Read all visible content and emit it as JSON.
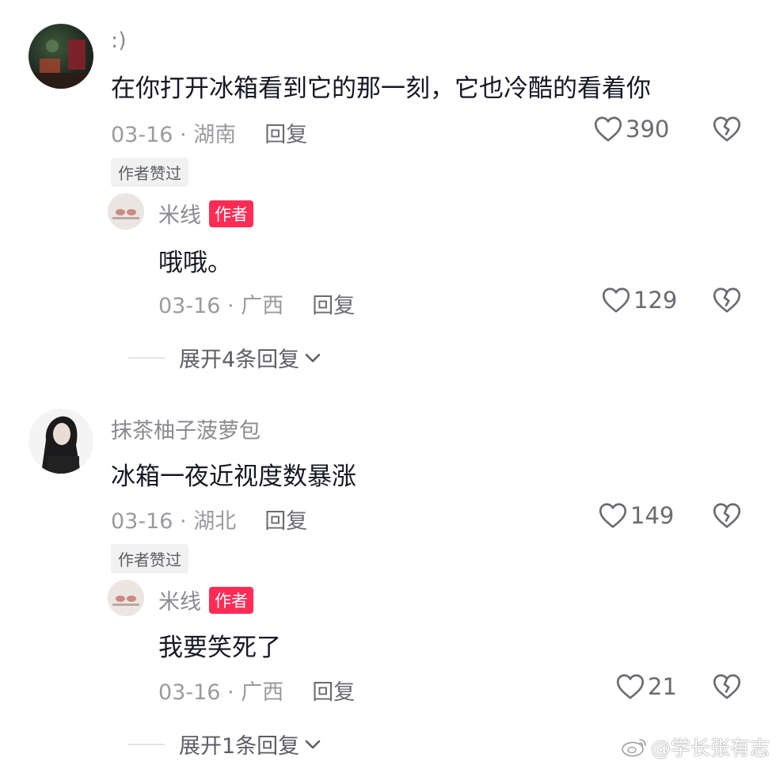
{
  "comments": [
    {
      "username": ":)",
      "text": "在你打开冰箱看到它的那一刻，它也冷酷的看着你",
      "date": "03-16",
      "location": "湖南",
      "reply_label": "回复",
      "likes": "390",
      "liked_by_author": "作者赞过",
      "author_reply": {
        "username": "米线",
        "author_tag": "作者",
        "text": "哦哦。",
        "date": "03-16",
        "location": "广西",
        "reply_label": "回复",
        "likes": "129"
      },
      "expand_label": "展开4条回复"
    },
    {
      "username": "抹茶柚子菠萝包",
      "text": "冰箱一夜近视度数暴涨",
      "date": "03-16",
      "location": "湖北",
      "reply_label": "回复",
      "likes": "149",
      "liked_by_author": "作者赞过",
      "author_reply": {
        "username": "米线",
        "author_tag": "作者",
        "text": "我要笑死了",
        "date": "03-16",
        "location": "广西",
        "reply_label": "回复",
        "likes": "21"
      },
      "expand_label": "展开1条回复"
    }
  ],
  "separator": " · ",
  "watermark": "@学长张有志",
  "colors": {
    "accent": "#fe2c55",
    "text": "#161823",
    "muted": "#9a9ba0"
  }
}
